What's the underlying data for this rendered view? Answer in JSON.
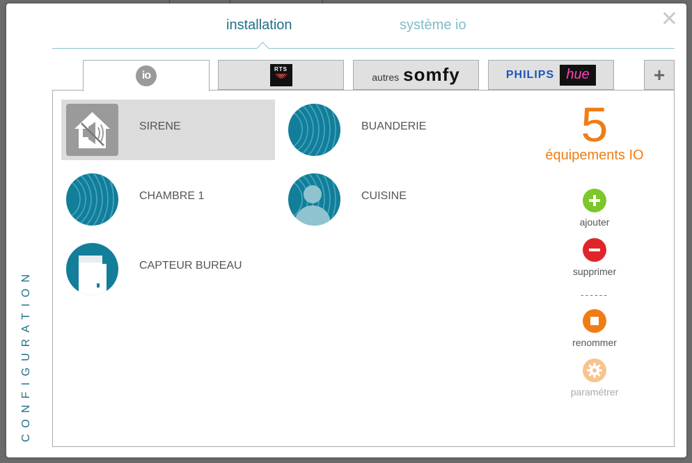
{
  "modal": {
    "close_glyph": "✕",
    "side_label": "CONFIGURATION"
  },
  "top_tabs": {
    "installation": "installation",
    "systeme_io": "système io"
  },
  "brand_tabs": {
    "io_logo": "io",
    "rts_logo": "RTS",
    "somfy_prefix": "autres",
    "somfy_name": "somfy",
    "philips": "PHILIPS",
    "hue": "hue",
    "add": "+"
  },
  "devices": [
    {
      "label": "SIRENE",
      "icon": "siren-house-icon"
    },
    {
      "label": "BUANDERIE",
      "icon": "io-waves-icon"
    },
    {
      "label": "CHAMBRE 1",
      "icon": "io-waves-icon"
    },
    {
      "label": "CUISINE",
      "icon": "person-waves-icon"
    },
    {
      "label": "CAPTEUR BUREAU",
      "icon": "sensor-icon"
    }
  ],
  "summary": {
    "count": "5",
    "count_label": "équipements IO"
  },
  "actions": {
    "add": "ajouter",
    "remove": "supprimer",
    "separator": "------",
    "rename": "renommer",
    "settings": "paramétrer"
  },
  "colors": {
    "accent": "#1e6f86",
    "orange": "#f07d14",
    "add_green": "#7cc72a",
    "remove_red": "#e0252a",
    "settings_faded": "#f8c38c",
    "device_teal": "#127e9a"
  }
}
